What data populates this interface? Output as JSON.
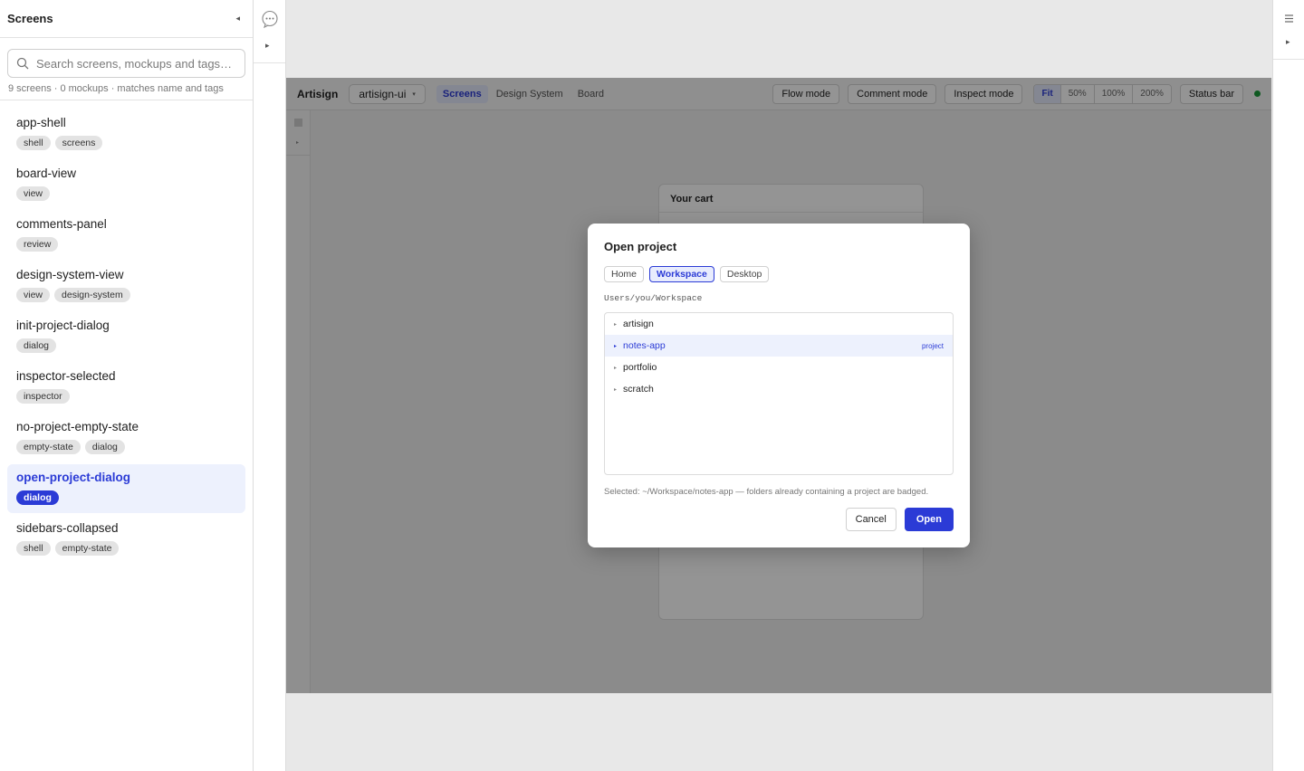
{
  "sidebar": {
    "title": "Screens",
    "collapse_glyph": "◂",
    "search_placeholder": "Search screens, mockups and tags…",
    "count_text": "9 screens · 0 mockups · matches name and tags",
    "screens": [
      {
        "name": "app-shell",
        "tags": [
          "shell",
          "screens"
        ]
      },
      {
        "name": "board-view",
        "tags": [
          "view"
        ]
      },
      {
        "name": "comments-panel",
        "tags": [
          "review"
        ]
      },
      {
        "name": "design-system-view",
        "tags": [
          "view",
          "design-system"
        ]
      },
      {
        "name": "init-project-dialog",
        "tags": [
          "dialog"
        ]
      },
      {
        "name": "inspector-selected",
        "tags": [
          "inspector"
        ]
      },
      {
        "name": "no-project-empty-state",
        "tags": [
          "empty-state",
          "dialog"
        ]
      },
      {
        "name": "open-project-dialog",
        "tags": [
          "dialog"
        ],
        "active": true
      },
      {
        "name": "sidebars-collapsed",
        "tags": [
          "shell",
          "empty-state"
        ]
      }
    ]
  },
  "rails": {
    "left_icon": "comment-icon",
    "left_arrow": "▸",
    "right_icon": "menu-icon",
    "right_arrow": "▸"
  },
  "app": {
    "brand": "Artisign",
    "project": "artisign-ui",
    "tabs": [
      "Screens",
      "Design System",
      "Board"
    ],
    "active_tab": "Screens",
    "modes": [
      "Flow mode",
      "Comment mode",
      "Inspect mode"
    ],
    "zoom": [
      "Fit",
      "50%",
      "100%",
      "200%"
    ],
    "active_zoom": "Fit",
    "status_bar": "Status bar",
    "status_color": "#1a9a3a"
  },
  "cart": {
    "title": "Your cart"
  },
  "dialog": {
    "title": "Open project",
    "locations": [
      "Home",
      "Workspace",
      "Desktop"
    ],
    "active_location": "Workspace",
    "path": "Users/you/Workspace",
    "folders": [
      {
        "name": "artisign",
        "badge": ""
      },
      {
        "name": "notes-app",
        "badge": "project",
        "selected": true
      },
      {
        "name": "portfolio",
        "badge": ""
      },
      {
        "name": "scratch",
        "badge": ""
      }
    ],
    "note": "Selected: ~/Workspace/notes-app — folders already containing a project are badged.",
    "cancel_label": "Cancel",
    "open_label": "Open"
  },
  "colors": {
    "accent": "#2b3bd6",
    "active_bg": "#edf1fd"
  }
}
